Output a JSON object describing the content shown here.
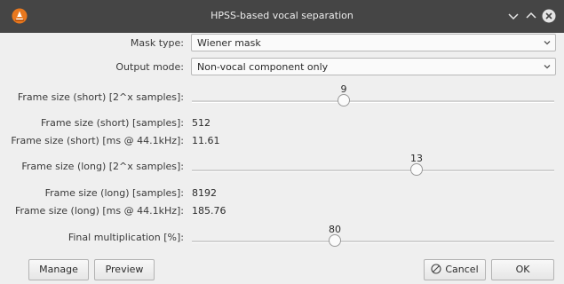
{
  "window": {
    "title": "HPSS-based vocal separation",
    "icon": "vlc-cone-icon",
    "controls": [
      "chevron-down-icon",
      "chevron-up-icon",
      "close-icon"
    ]
  },
  "form": {
    "mask_type": {
      "label": "Mask type:",
      "value": "Wiener mask"
    },
    "output_mode": {
      "label": "Output mode:",
      "value": "Non-vocal component only"
    },
    "frame_short_exp": {
      "label": "Frame size (short) [2^x samples]:",
      "value": 9,
      "fraction": 0.42
    },
    "frame_short_samples": {
      "label": "Frame size (short) [samples]:",
      "value": "512"
    },
    "frame_short_ms": {
      "label": "Frame size (short) [ms @ 44.1kHz]:",
      "value": "11.61"
    },
    "frame_long_exp": {
      "label": "Frame size (long) [2^x samples]:",
      "value": 13,
      "fraction": 0.62
    },
    "frame_long_samples": {
      "label": "Frame size (long) [samples]:",
      "value": "8192"
    },
    "frame_long_ms": {
      "label": "Frame size (long) [ms @ 44.1kHz]:",
      "value": "185.76"
    },
    "final_mult": {
      "label": "Final multiplication [%]:",
      "value": 80,
      "fraction": 0.395
    }
  },
  "buttons": {
    "manage": "Manage",
    "preview": "Preview",
    "cancel": "Cancel",
    "ok": "OK"
  },
  "colors": {
    "titlebar": "#454545",
    "background": "#efefef"
  }
}
